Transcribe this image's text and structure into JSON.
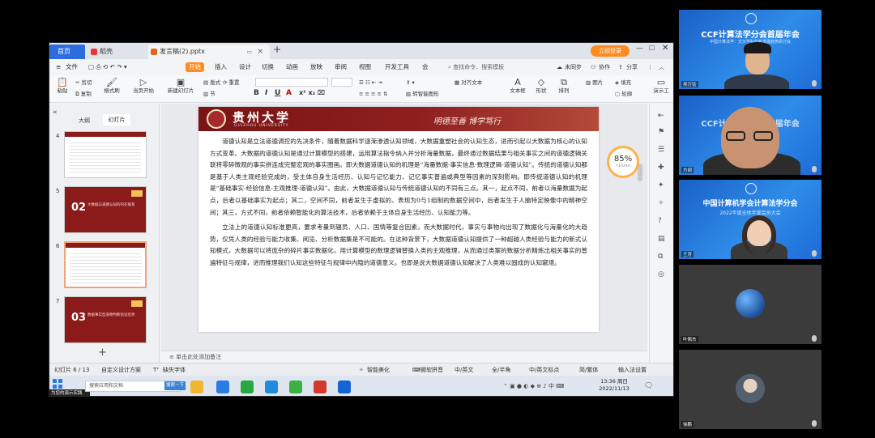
{
  "tabs": {
    "home": "首页",
    "shell": "稻壳",
    "doc": "发言稿(2).pptx",
    "new_tab": "+",
    "login": "立即登录"
  },
  "menu": {
    "file": "文件",
    "start": "开始",
    "insert": "插入",
    "design": "设计",
    "transition": "切换",
    "animation": "动画",
    "slideshow": "放映",
    "review": "审阅",
    "view": "视图",
    "devtools": "开发工具",
    "member": "会",
    "search_placeholder": "查找命令、搜索模板",
    "sync": "未同步",
    "collab": "协作",
    "share": "分享"
  },
  "ribbon": {
    "paste": "粘贴",
    "cut": "剪切",
    "copy": "复制",
    "format_painter": "格式刷",
    "play_from_current": "当页开始",
    "new_slide": "新建幻灯片",
    "layout": "版式",
    "section": "节",
    "reset": "重置",
    "textbox": "文本框",
    "shape": "形状",
    "arrange": "排列",
    "picture": "图片",
    "fill": "填充",
    "outline": "轮廓",
    "presenter": "演示工",
    "to_smartart": "转智能图形",
    "text_effects": "对齐文本"
  },
  "sidebar": {
    "outline_tab": "大纲",
    "slides_tab": "幻灯片",
    "thumbs": [
      {
        "num": "4",
        "big": "",
        "sub": ""
      },
      {
        "num": "5",
        "big": "02",
        "sub": "大数据与道德认知的内在联系"
      },
      {
        "num": "6",
        "big": "",
        "sub": ""
      },
      {
        "num": "7",
        "big": "03",
        "sub": "数据事实型道德判断验证优势"
      }
    ]
  },
  "slide": {
    "school_cn": "贵州大学",
    "school_en": "GUIZHOU UNIVERSITY",
    "motto": "明德至善 博学笃行",
    "paragraphs": [
      "道德认知是立法道德调控的先决条件，随着数据科学逐渐渗透认知领域，大数据重塑社会的认知生态，进而引起以大数据为核心的认知方式变革。大数据的道德认知是通过计算模型的搭建，运用算法指令纳入并分析海量数据，最终通过数据结果与相关事实之间的道德逻辑关联将零碎微观的事实拼连成完整宏观的事实图画。即大数据道德认知的机理是“海量数据-事实信息-数理逻辑-道德认知”。传统的道德认知都是基于人类主观经验完成的，受主体自身生活经历、认知与记忆能力、记忆事实普遍或典型等因素的深刻影响。即传统道德认知的机理是“基础事实-经验信息-主观推理-道德认知”。由此，大数据道德认知与传统道德认知的不同有三点。其一，起点不同，前者以海量数据为起点，后者以基础事实为起点；其二，空间不同，前者发生于虚拟的、表现为0与1组制的数据空间中，后者发生于人脑特定映像中的精神空间；其三，方式不同，前者依赖智能化的算法技术，后者依赖于主体自身生活经历、认知能力等。",
      "立法上的道德认知标准更高，要求考量到辐员、人口、国情等复合因素，而大数据时代，事实与事物均出现了数据化与海量化的大趋势，仅凭人类的经验与能力收集、阅览、分析数据集是不可能的。在这种背景下，大数据道德认知提供了一种超越人类经验与能力的新式认知模式，大数据可以将庞杂的碎片事实数据化，用计算模型的数理逻辑替换人类的主观推理，从而通过类案的数据分析精炼出相关事实的普遍特征与规律，进而推理我们认知这些特征与规律中内隐的道德意义。也即是说大数据道德认知解决了人类难以固成的认知窘境。"
    ]
  },
  "zoom": {
    "percent": "85%",
    "speed": "↑102K/s"
  },
  "notes_placeholder": "单击此处添加备注",
  "status": {
    "slide_count": "幻灯片 6 / 13",
    "theme": "自定义设计方案",
    "missing_font": "缺失字体",
    "beautify": "智能美化",
    "ime1": "微软拼音",
    "ime2": "中/英文",
    "ime3": "全/半角",
    "ime4": "中/英文标点",
    "ime5": "简/繁体",
    "ime6": "输入法设置"
  },
  "taskbar": {
    "start_tip": "为您的演示实践",
    "search_placeholder": "搜索应用和文档",
    "search_button": "搜索一下",
    "time": "13:36 周日",
    "date": "2022/11/13"
  },
  "participants": [
    {
      "title": "CCF计算法学分会首届年会",
      "sub": "中国计算法学：交叉学科的新发展趋势研讨会",
      "name": "吴万钰"
    },
    {
      "title": "CCF计算法学分会首届年会",
      "sub": "",
      "name": "方闻"
    },
    {
      "title": "中国计算机学会计算法学分会",
      "sub": "2022年度全体年度会员大会",
      "name": "王芳"
    },
    {
      "title": "",
      "sub": "",
      "name": "叶佩杰"
    },
    {
      "title": "",
      "sub": "",
      "name": "徐鹏"
    }
  ],
  "colors": {
    "accent_orange": "#ff8a1d",
    "banner_red": "#8b1a1a",
    "tile_blue": "#1a5fc7"
  }
}
